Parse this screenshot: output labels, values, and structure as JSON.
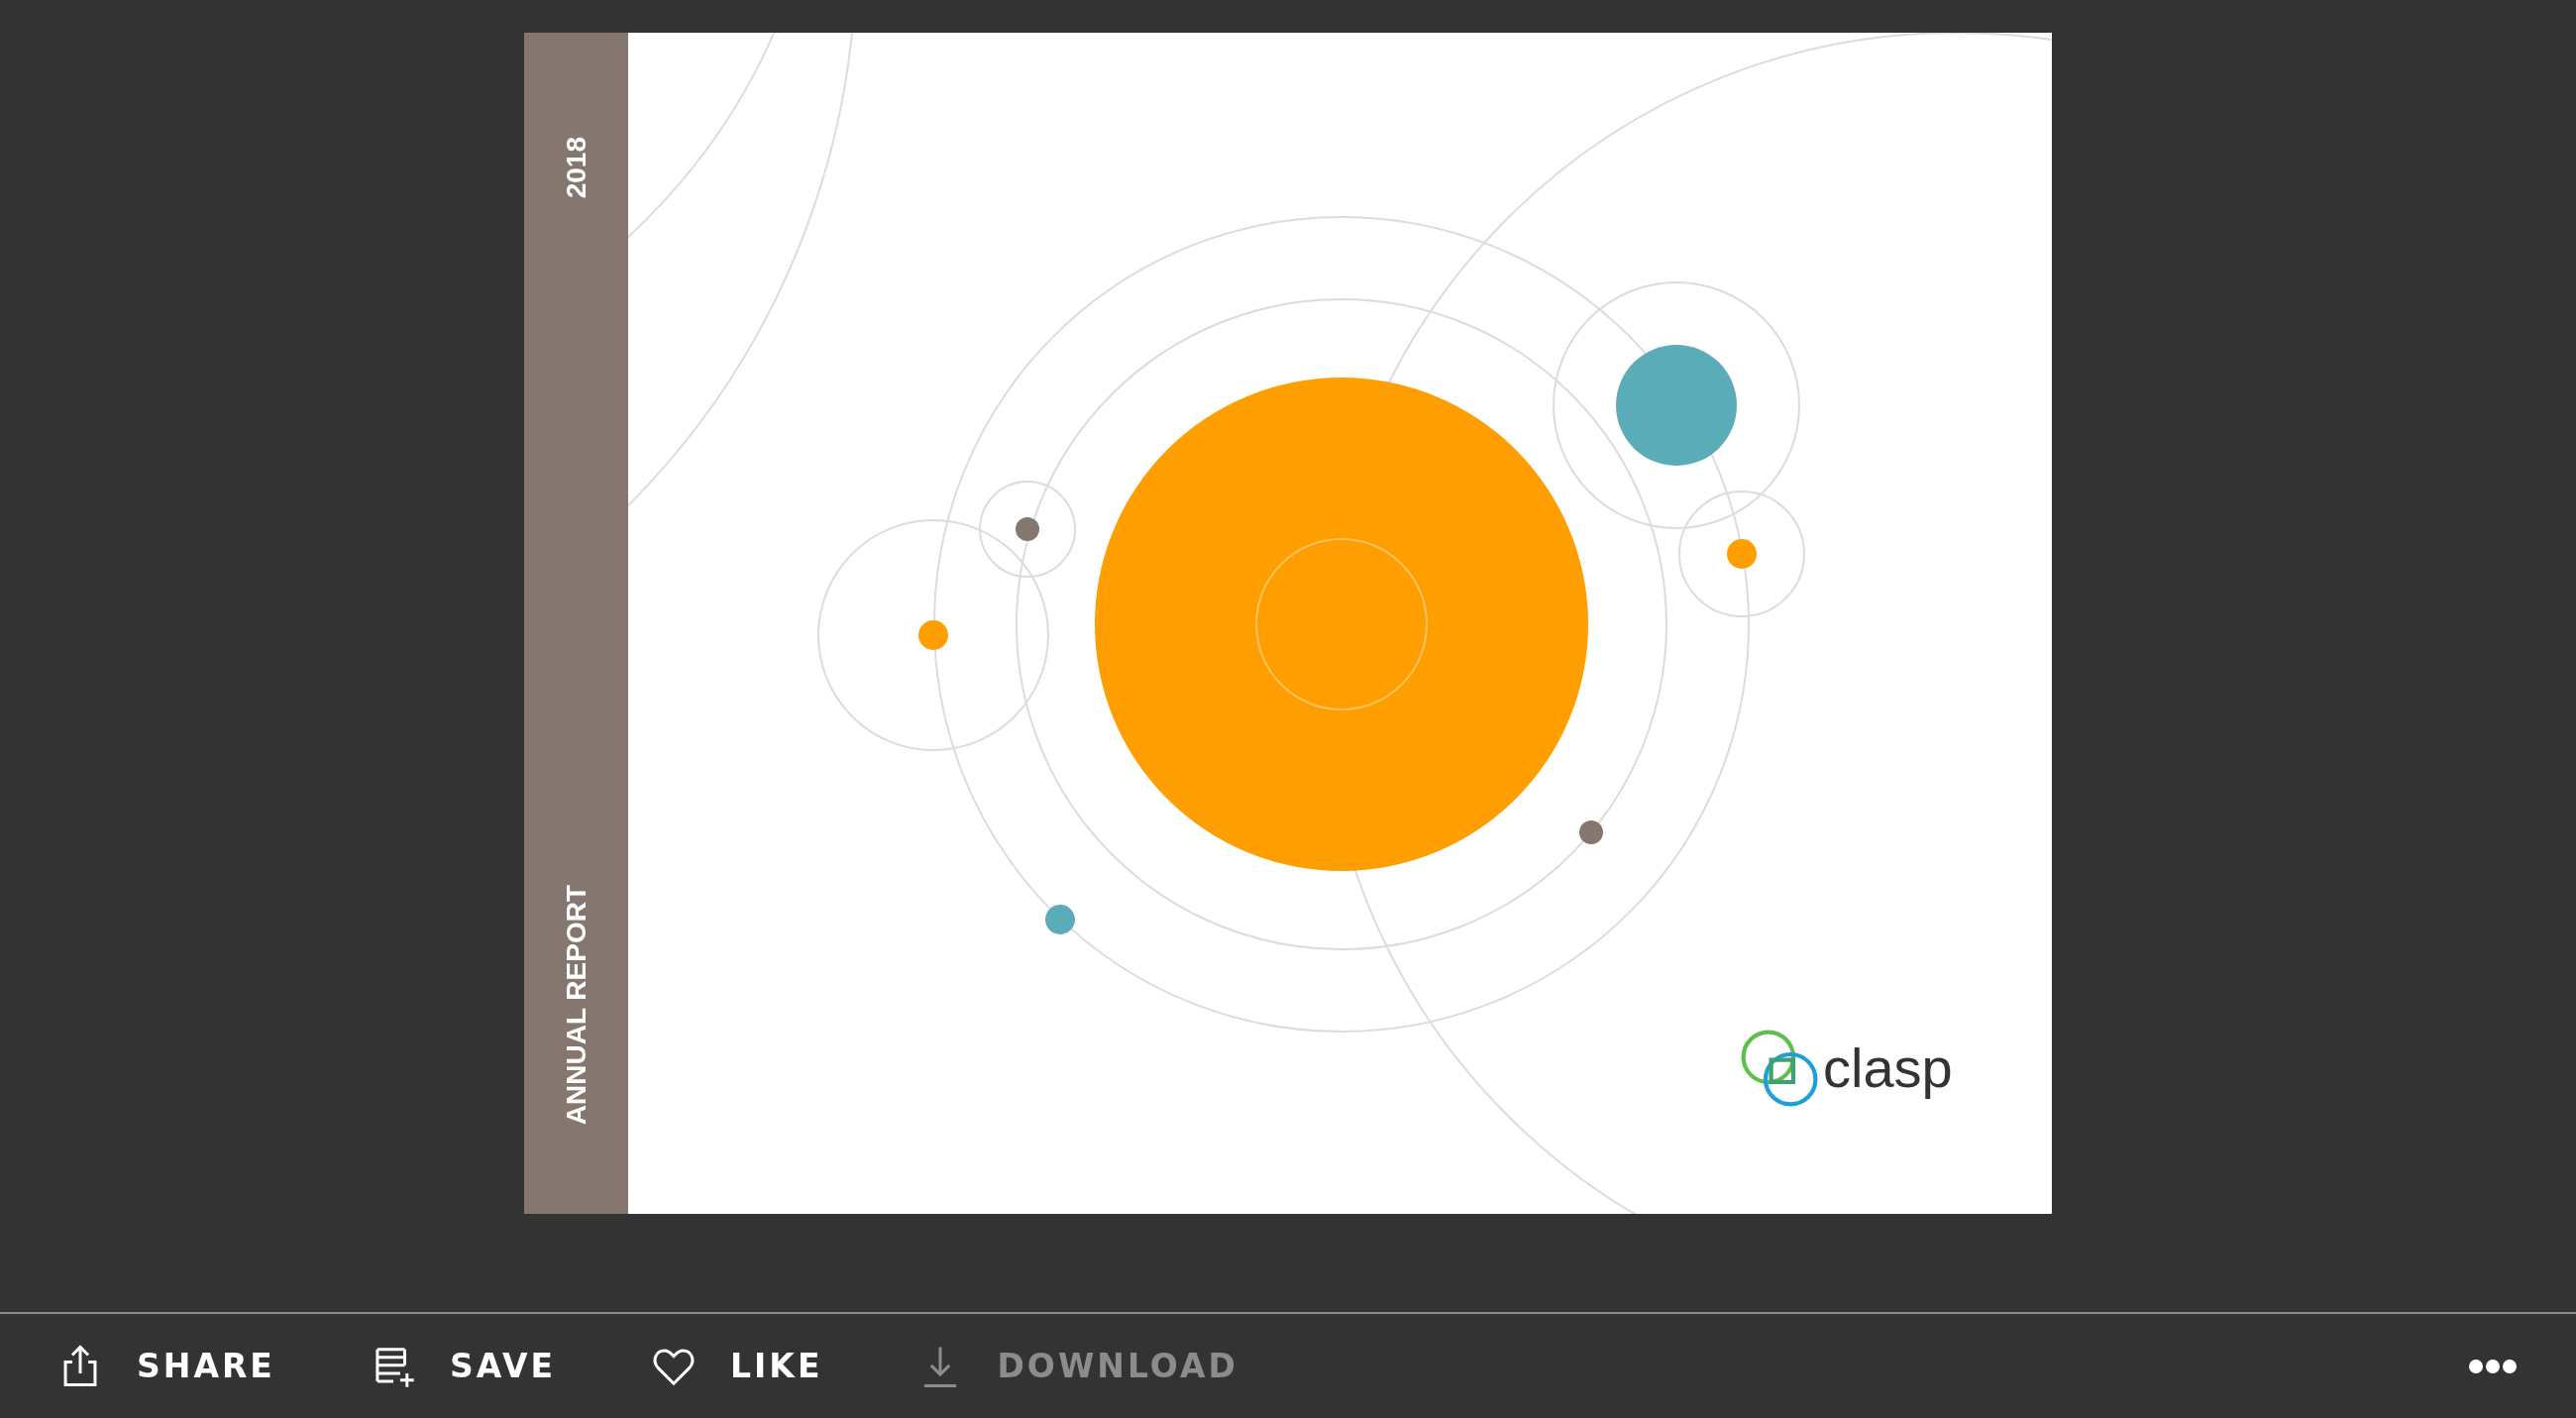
{
  "document": {
    "spine": {
      "year": "2018",
      "title": "ANNUAL REPORT"
    },
    "logo": {
      "text": "clasp"
    }
  },
  "toolbar": {
    "actions": [
      {
        "kind": "share",
        "label": "SHARE",
        "disabled": false
      },
      {
        "kind": "save",
        "label": "SAVE",
        "disabled": false
      },
      {
        "kind": "like",
        "label": "LIKE",
        "disabled": false
      },
      {
        "kind": "download",
        "label": "DOWNLOAD",
        "disabled": true
      }
    ]
  }
}
